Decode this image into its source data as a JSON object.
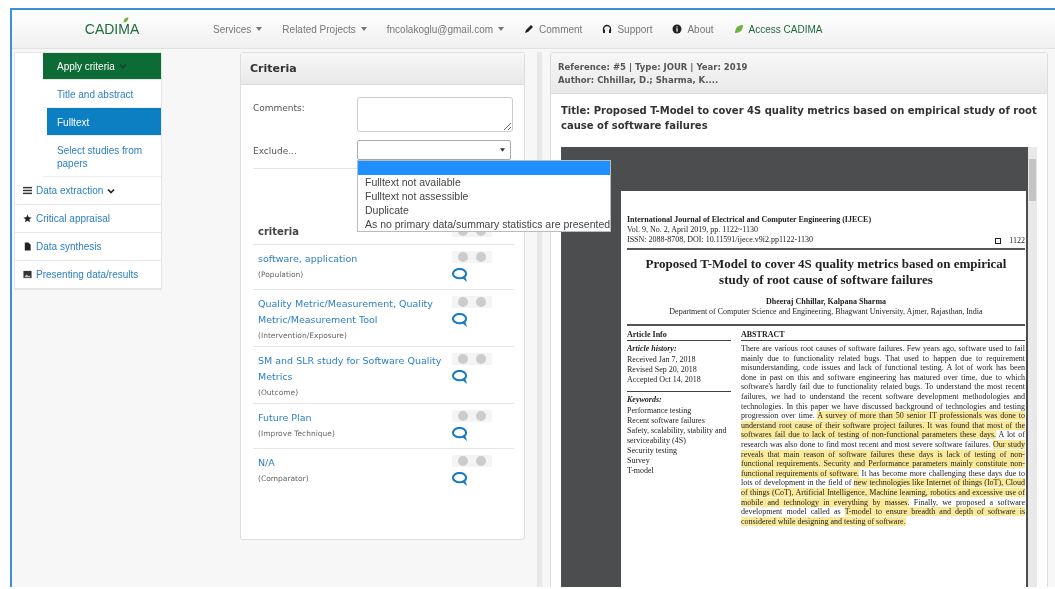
{
  "header": {
    "logo": "CADIMA",
    "nav": [
      {
        "label": "Services",
        "kind": "dropdown"
      },
      {
        "label": "Related Projects",
        "kind": "dropdown"
      },
      {
        "label": "fncolakoglu@gmail.com",
        "kind": "dropdown"
      },
      {
        "label": "Comment",
        "kind": "comment"
      },
      {
        "label": "Support",
        "kind": "support"
      },
      {
        "label": "About",
        "kind": "about"
      },
      {
        "label": "Access CADIMA",
        "kind": "access"
      }
    ]
  },
  "sidebar": {
    "items": [
      {
        "label": "Apply criteria",
        "kind": "none",
        "selected": true,
        "expanded": true,
        "children": [
          {
            "label": "Title and abstract",
            "selected": false
          },
          {
            "label": "Fulltext",
            "selected": true
          },
          {
            "label": "Select studies from papers",
            "selected": false
          }
        ]
      },
      {
        "label": "Data extraction",
        "kind": "list",
        "selected": false,
        "has_submenu": true
      },
      {
        "label": "Critical appraisal",
        "kind": "star",
        "selected": false
      },
      {
        "label": "Data synthesis",
        "kind": "file",
        "selected": false
      },
      {
        "label": "Presenting data/results",
        "kind": "image",
        "selected": false
      }
    ]
  },
  "criteria_panel": {
    "title": "Criteria",
    "comments_label": "Comments:",
    "exclude_label": "Exclude...",
    "exclude_dropdown": {
      "open": true,
      "options": [
        {
          "selected": true
        },
        {
          "label": "Fulltext not available",
          "selected": false
        },
        {
          "label": "Fulltext not assessible",
          "selected": false
        },
        {
          "label": "Duplicate",
          "selected": false
        },
        {
          "label": "As no primary data/summary statistics are presented",
          "selected": false
        }
      ]
    },
    "criteria_heading": "criteria",
    "criteria": [
      {
        "name": "software, application",
        "category": "(Population)"
      },
      {
        "name": "Quality Metric/Measurement, Quality Metric/Measurement Tool",
        "category": "(Intervention/Exposure)"
      },
      {
        "name": "SM and SLR study for Software Quality Metrics",
        "category": "(Outcome)"
      },
      {
        "name": "Future Plan",
        "category": "(Improve Technique)"
      },
      {
        "name": "N/A",
        "category": "(Comparator)"
      }
    ]
  },
  "reference_panel": {
    "reference": "Reference: #5 | Type: JOUR | Year: 2019",
    "author": "Author: Chhillar, D.; Sharma, K....",
    "title": "Title: Proposed T-Model to cover 4S quality metrics based on empirical study of root cause of software failures",
    "document": {
      "journal": "International Journal of Electrical and Computer Engineering (IJECE)",
      "volume": "Vol. 9, No. 2, April 2019, pp. 1122~1130",
      "issn": "ISSN: 2088-8708, DOI: 10.11591/ijece.v9i2.pp1122-1130",
      "page_number": "1122",
      "title": "Proposed T-Model to cover 4S quality metrics based on empirical study of root cause of software failures",
      "authors": "Dheeraj Chhillar, Kalpana Sharma",
      "affiliation": "Department of Computer Science and Engineering, Bhagwant University, Ajmer, Rajasthan, India",
      "info_heading": "Article Info",
      "history_heading": "Article history:",
      "history": [
        "Received Jan 7, 2018",
        "Revised Sep 20, 2018",
        "Accepted Oct 14, 2018"
      ],
      "keywords_heading": "Keywords:",
      "keywords": [
        "Performance testing",
        "Recent software failures",
        "Safety, scalability, stability and serviceability (4S)",
        "Security testing",
        "Survey",
        "T-model"
      ],
      "abstract_heading": "ABSTRACT",
      "abstract": [
        {
          "text": "There are various root causes of software failures. Few years ago, software used to fail mainly due to functionality related bugs. That used to happen due to requirement misunderstanding, code issues and lack of functional testing. A lot of work has been done in past on this and software engineering has matured over time, due to which software's hardly fail due to functionality related bugs. To understand the most recent failures, we had to understand the recent software development methodologies and technologies. In this paper we have discussed background of technologies and testing progression over time. ",
          "highlighted": false
        },
        {
          "text": "A survey of more than 50 senior IT professionals was done to understand root cause of their software project failures. It was found that most of the softwares fail due to lack of testing of non-functional parameters these days.",
          "highlighted": true
        },
        {
          "text": " A lot of research was also done to find most recent and most severe software failures. ",
          "highlighted": false
        },
        {
          "text": "Our study reveals that main reason of software failures these days is lack of testing of non-functional requirements. Security and Performance parameters mainly constitute non-functional requirements of software.",
          "highlighted": true
        },
        {
          "text": " It has become more challenging these days due to lots of development in the field of ",
          "highlighted": false
        },
        {
          "text": "new technologies like Internet of things (IoT), Cloud of things (CoT), Artificial Intelligence, Machine learning, robotics and excessive use of mobile and technology in everything by masses.",
          "highlighted": true
        },
        {
          "text": " Finally, we proposed a software development model called as ",
          "highlighted": false
        },
        {
          "text": "T-model to ensure breadth and depth of software is considered while designing and testing of software.",
          "highlighted": true
        }
      ]
    }
  }
}
